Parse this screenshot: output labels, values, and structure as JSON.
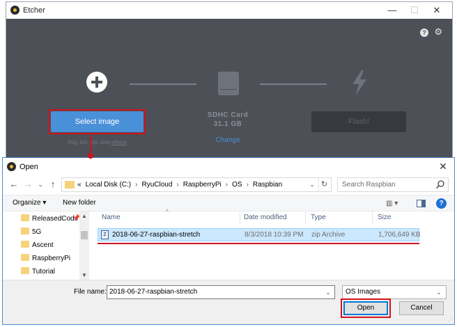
{
  "etcher": {
    "title": "Etcher",
    "window_controls": {
      "minimize": "—",
      "maximize": "☐",
      "close": "✕"
    },
    "top_icons": {
      "help": "?",
      "settings": "⚙"
    },
    "image_step": {
      "button_label": "Select image",
      "supported_prefix": "img, iso, zip, and ",
      "supported_link": "others"
    },
    "drive_step": {
      "name": "SDHC Card",
      "size": "31.1 GB",
      "change_label": "Change"
    },
    "flash_step": {
      "button_label": "Flash!"
    },
    "colors": {
      "background": "#4d5057",
      "accent": "#4a90d9",
      "annotation": "#d0121d"
    }
  },
  "open_dialog": {
    "title": "Open",
    "close": "✕",
    "nav": {
      "back": "←",
      "forward": "→",
      "recent": "⌄",
      "up": "↑"
    },
    "address_bar": {
      "path": [
        "«",
        "Local Disk (C:)",
        "RyuCloud",
        "RaspberryPi",
        "OS",
        "Raspbian"
      ],
      "separator": "›",
      "dropdown": "⌄",
      "refresh": "↻"
    },
    "search": {
      "placeholder": "Search Raspbian",
      "icon": "search-icon"
    },
    "toolbar": {
      "organize": "Organize ▾",
      "new_folder": "New folder",
      "view": "▥ ▾",
      "help": "?"
    },
    "nav_pane": {
      "items": [
        "ReleasedCode",
        "5G",
        "Ascent",
        "RaspberryPi",
        "Tutorial"
      ],
      "pin": "📌",
      "scroll_up": "▲",
      "scroll_down": "▼"
    },
    "file_list": {
      "columns": [
        "Name",
        "Date modified",
        "Type",
        "Size"
      ],
      "sort_indicator": "^",
      "rows": [
        {
          "name": "2018-06-27-raspbian-stretch",
          "date_modified": "8/3/2018 10:39 PM",
          "type": "zip Archive",
          "size": "1,706,649 KB",
          "icon": "zip-icon",
          "icon_glyph": "Z",
          "selected": true
        }
      ]
    },
    "file_name": {
      "label": "File name:",
      "value": "2018-06-27-raspbian-stretch",
      "dropdown": "⌄"
    },
    "file_type": {
      "value": "OS Images",
      "dropdown": "⌄"
    },
    "buttons": {
      "open": "Open",
      "cancel": "Cancel"
    },
    "grip": "⋰"
  }
}
